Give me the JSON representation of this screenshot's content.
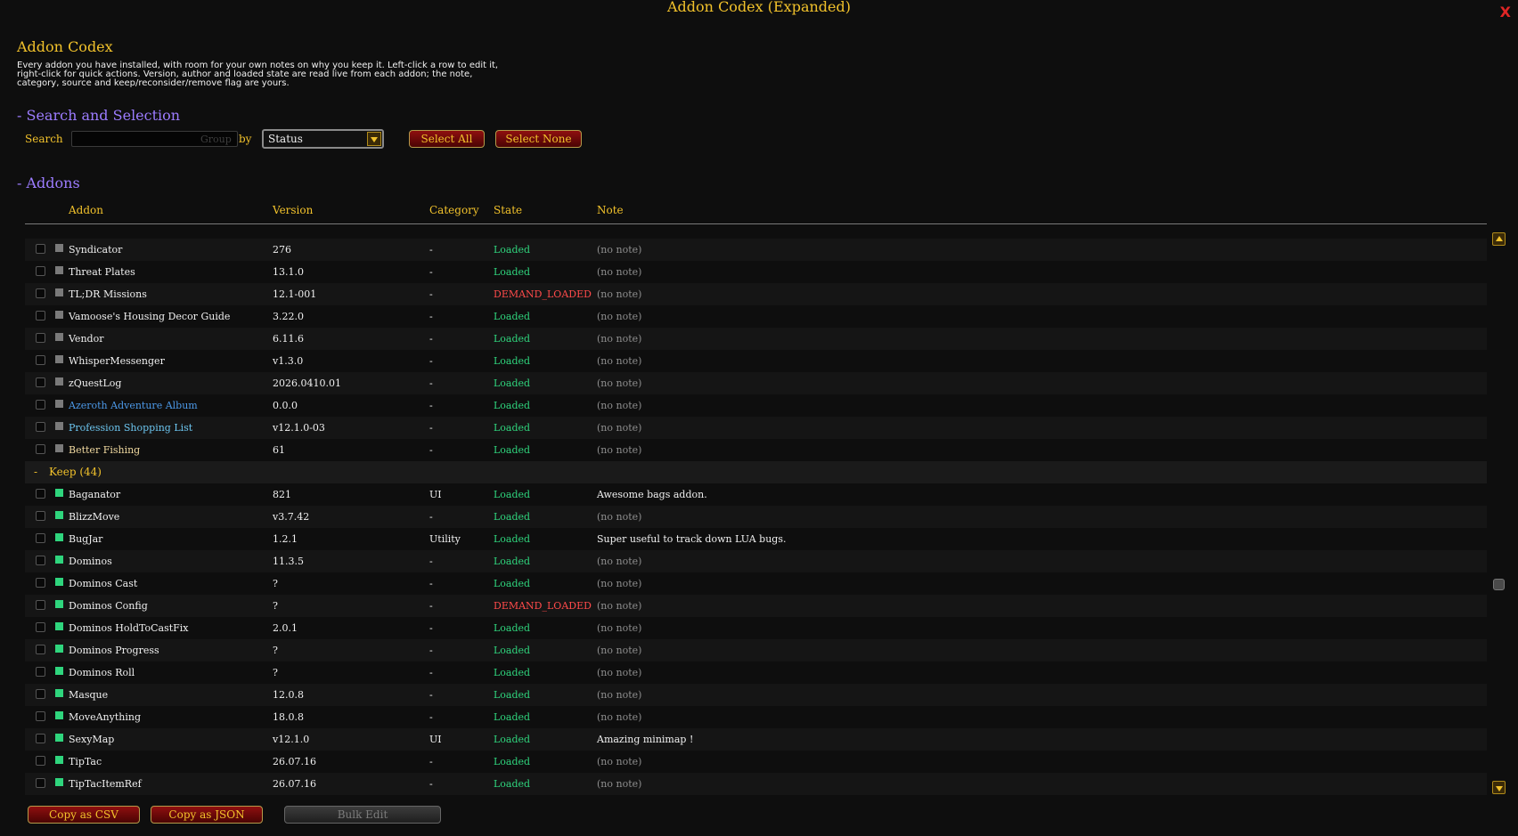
{
  "window": {
    "title": "Addon Codex (Expanded)",
    "close_label": "X"
  },
  "header": {
    "title": "Addon Codex",
    "description": "Every addon you have installed, with room for your own notes on why you keep it. Left-click a row to edit it, right-click for quick actions. Version, author and loaded state are read live from each addon; the note, category, source and keep/reconsider/remove flag are yours."
  },
  "search_section": {
    "title": "- Search and Selection",
    "search_label": "Search",
    "search_value": "",
    "group_hint": "Group",
    "by_label": "by",
    "group_by_value": "Status",
    "select_all": "Select All",
    "select_none": "Select None"
  },
  "addons_section": {
    "title": "- Addons",
    "columns": [
      "Addon",
      "Version",
      "Category",
      "State",
      "Note"
    ],
    "colors": {
      "uncategorized": "#7a7a7a",
      "keep": "#2fd57d",
      "loaded": "#2fd57d",
      "demand_loaded": "#ff4a4a"
    },
    "rows_before": [
      {
        "name": "Syndicator",
        "version": "276",
        "category": "-",
        "state": "Loaded",
        "note": "(no note)"
      },
      {
        "name": "Threat Plates",
        "version": "13.1.0",
        "category": "-",
        "state": "Loaded",
        "note": "(no note)"
      },
      {
        "name": "TL;DR Missions",
        "version": "12.1-001",
        "category": "-",
        "state": "DEMAND_LOADED",
        "note": "(no note)"
      },
      {
        "name": "Vamoose's Housing Decor Guide",
        "version": "3.22.0",
        "category": "-",
        "state": "Loaded",
        "note": "(no note)"
      },
      {
        "name": "Vendor",
        "version": "6.11.6",
        "category": "-",
        "state": "Loaded",
        "note": "(no note)"
      },
      {
        "name": "WhisperMessenger",
        "version": "v1.3.0",
        "category": "-",
        "state": "Loaded",
        "note": "(no note)"
      },
      {
        "name": "zQuestLog",
        "version": "2026.0410.01",
        "category": "-",
        "state": "Loaded",
        "note": "(no note)"
      },
      {
        "name": "Azeroth Adventure Album",
        "version": "0.0.0",
        "category": "-",
        "state": "Loaded",
        "note": "(no note)",
        "style": "blue"
      },
      {
        "name": "Profession Shopping List",
        "version": "v12.1.0-03",
        "category": "-",
        "state": "Loaded",
        "note": "(no note)",
        "style": "cyan"
      },
      {
        "name": "Better Fishing",
        "version": "61",
        "category": "-",
        "state": "Loaded",
        "note": "(no note)",
        "style": "gold"
      }
    ],
    "keep_group": {
      "toggle": "-",
      "label": "Keep (44)"
    },
    "keep_rows": [
      {
        "name": "Baganator",
        "version": "821",
        "category": "UI",
        "state": "Loaded",
        "note": "Awesome bags addon."
      },
      {
        "name": "BlizzMove",
        "version": "v3.7.42",
        "category": "-",
        "state": "Loaded",
        "note": "(no note)"
      },
      {
        "name": "BugJar",
        "version": "1.2.1",
        "category": "Utility",
        "state": "Loaded",
        "note": "Super useful to track down LUA bugs."
      },
      {
        "name": "Dominos",
        "version": "11.3.5",
        "category": "-",
        "state": "Loaded",
        "note": "(no note)"
      },
      {
        "name": "Dominos Cast",
        "version": "?",
        "category": "-",
        "state": "Loaded",
        "note": "(no note)"
      },
      {
        "name": "Dominos Config",
        "version": "?",
        "category": "-",
        "state": "DEMAND_LOADED",
        "note": "(no note)"
      },
      {
        "name": "Dominos HoldToCastFix",
        "version": "2.0.1",
        "category": "-",
        "state": "Loaded",
        "note": "(no note)"
      },
      {
        "name": "Dominos Progress",
        "version": "?",
        "category": "-",
        "state": "Loaded",
        "note": "(no note)"
      },
      {
        "name": "Dominos Roll",
        "version": "?",
        "category": "-",
        "state": "Loaded",
        "note": "(no note)"
      },
      {
        "name": "Masque",
        "version": "12.0.8",
        "category": "-",
        "state": "Loaded",
        "note": "(no note)"
      },
      {
        "name": "MoveAnything",
        "version": "18.0.8",
        "category": "-",
        "state": "Loaded",
        "note": "(no note)"
      },
      {
        "name": "SexyMap",
        "version": "v12.1.0",
        "category": "UI",
        "state": "Loaded",
        "note": "Amazing minimap !"
      },
      {
        "name": "TipTac",
        "version": "26.07.16",
        "category": "-",
        "state": "Loaded",
        "note": "(no note)"
      },
      {
        "name": "TipTacItemRef",
        "version": "26.07.16",
        "category": "-",
        "state": "Loaded",
        "note": "(no note)"
      }
    ]
  },
  "footer": {
    "copy_csv": "Copy as CSV",
    "copy_json": "Copy as JSON",
    "bulk_edit": "Bulk Edit"
  }
}
